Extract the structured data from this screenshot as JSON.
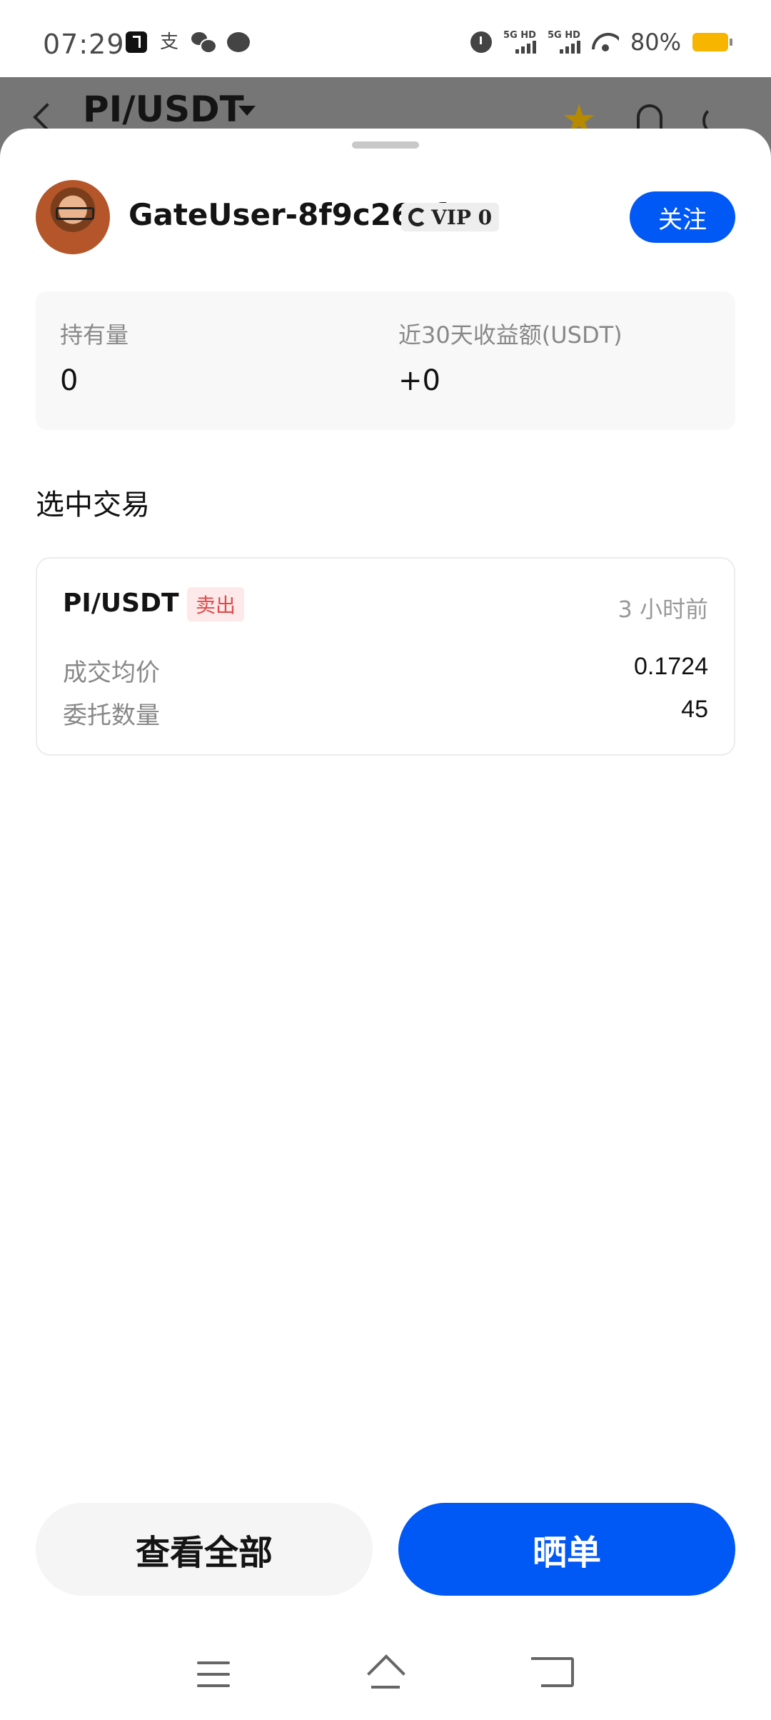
{
  "status_bar": {
    "time": "07:29",
    "alipay_glyph": "支",
    "signal1_label": "5G HD",
    "signal2_label": "5G HD",
    "battery_percent": "80%",
    "battery_color": "#f7b500",
    "icons": [
      "tiktok-icon",
      "alipay-icon",
      "wechat-icon",
      "message-icon",
      "alarm-icon",
      "signal-icon",
      "wifi-icon",
      "battery-icon"
    ]
  },
  "header": {
    "pair": "PI/USDT",
    "icons": [
      "back-icon",
      "caret-down-icon",
      "star-icon",
      "bell-icon",
      "share-icon"
    ]
  },
  "profile": {
    "username": "GateUser-8f9c264f",
    "vip_label": "VIP 0",
    "follow_label": "关注"
  },
  "stats": {
    "holdings_label": "持有量",
    "holdings_value": "0",
    "pnl_label": "近30天收益额(USDT)",
    "pnl_value": "+0"
  },
  "selected_trade": {
    "section_title": "选中交易",
    "pair": "PI/USDT",
    "side": "卖出",
    "time_ago": "3 小时前",
    "avg_price_label": "成交均价",
    "avg_price_value": "0.1724",
    "amount_label": "委托数量",
    "amount_value": "45"
  },
  "actions": {
    "view_all_label": "查看全部",
    "share_label": "晒单"
  },
  "colors": {
    "accent": "#0058f5",
    "sell_red": "#e04a4a",
    "sell_bg": "#fde9e9"
  }
}
